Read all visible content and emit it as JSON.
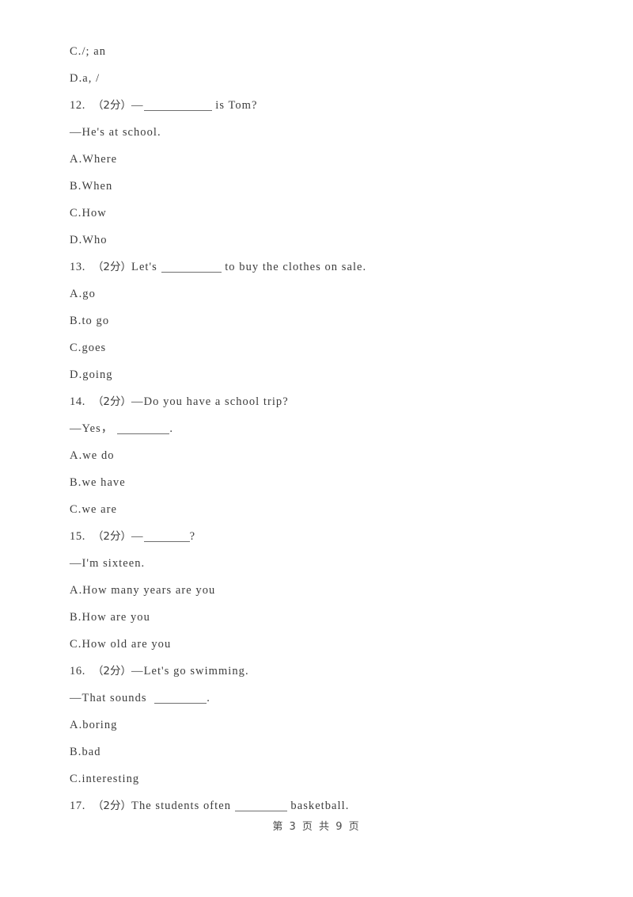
{
  "document": {
    "page_footer": "第 3 页 共 9 页",
    "page_number": "3",
    "total_pages": "9",
    "text_color": "#3c3c3c",
    "background_color": "#ffffff"
  },
  "lines": [
    {
      "id": "l1",
      "kind": "option",
      "marker": "C",
      "text": "/; an"
    },
    {
      "id": "l2",
      "kind": "option",
      "marker": "D",
      "text": "a, /"
    },
    {
      "id": "l3",
      "kind": "question",
      "number": "12.",
      "score": "（2分）",
      "pre": "—",
      "blank": "xl",
      "post": " is Tom?"
    },
    {
      "id": "l4",
      "kind": "plain",
      "text": "—He's at school."
    },
    {
      "id": "l5",
      "kind": "option",
      "marker": "A",
      "text": "Where"
    },
    {
      "id": "l6",
      "kind": "option",
      "marker": "B",
      "text": "When"
    },
    {
      "id": "l7",
      "kind": "option",
      "marker": "C",
      "text": "How"
    },
    {
      "id": "l8",
      "kind": "option",
      "marker": "D",
      "text": "Who"
    },
    {
      "id": "l9",
      "kind": "question",
      "number": "13.",
      "score": "（2分）",
      "pre": "Let's ",
      "blank": "lg",
      "post": " to buy the clothes on sale."
    },
    {
      "id": "l10",
      "kind": "option",
      "marker": "A",
      "text": "go"
    },
    {
      "id": "l11",
      "kind": "option",
      "marker": "B",
      "text": "to go"
    },
    {
      "id": "l12",
      "kind": "option",
      "marker": "C",
      "text": "goes"
    },
    {
      "id": "l13",
      "kind": "option",
      "marker": "D",
      "text": "going"
    },
    {
      "id": "l14",
      "kind": "question",
      "number": "14.",
      "score": "（2分）",
      "pre": "—Do you have a school trip?",
      "blank": "",
      "post": ""
    },
    {
      "id": "l15",
      "kind": "blankline",
      "pre": "—Yes，",
      "blank": "md",
      "post": "."
    },
    {
      "id": "l16",
      "kind": "option",
      "marker": "A",
      "text": "we do"
    },
    {
      "id": "l17",
      "kind": "option",
      "marker": "B",
      "text": "we have"
    },
    {
      "id": "l18",
      "kind": "option",
      "marker": "C",
      "text": "we are"
    },
    {
      "id": "l19",
      "kind": "question",
      "number": "15.",
      "score": "（2分）",
      "pre": "—",
      "blank": "sm",
      "post": "?"
    },
    {
      "id": "l20",
      "kind": "plain",
      "text": "—I'm sixteen."
    },
    {
      "id": "l21",
      "kind": "option",
      "marker": "A",
      "text": "How many years are you"
    },
    {
      "id": "l22",
      "kind": "option",
      "marker": "B",
      "text": "How are you"
    },
    {
      "id": "l23",
      "kind": "option",
      "marker": "C",
      "text": "How old are you"
    },
    {
      "id": "l24",
      "kind": "question",
      "number": "16.",
      "score": "（2分）",
      "pre": "—Let's go swimming.",
      "blank": "",
      "post": ""
    },
    {
      "id": "l25",
      "kind": "blankline",
      "pre": "—That sounds ",
      "blank": "md",
      "post": "."
    },
    {
      "id": "l26",
      "kind": "option",
      "marker": "A",
      "text": "boring"
    },
    {
      "id": "l27",
      "kind": "option",
      "marker": "B",
      "text": "bad"
    },
    {
      "id": "l28",
      "kind": "option",
      "marker": "C",
      "text": "interesting"
    },
    {
      "id": "l29",
      "kind": "question",
      "number": "17.",
      "score": "（2分）",
      "pre": "The students often ",
      "blank": "md",
      "post": " basketball."
    }
  ]
}
